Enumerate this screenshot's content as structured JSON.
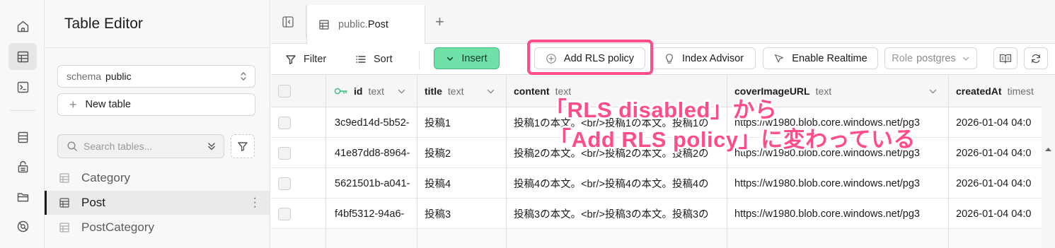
{
  "rail": {
    "items": [
      {
        "icon": "home-icon"
      },
      {
        "icon": "table-editor-icon",
        "active": true
      },
      {
        "icon": "sql-editor-icon"
      },
      {
        "icon": "database-icon"
      },
      {
        "icon": "auth-lock-icon"
      },
      {
        "icon": "storage-icon"
      },
      {
        "icon": "realtime-icon"
      }
    ]
  },
  "sidebar": {
    "title": "Table Editor",
    "schema_label": "schema",
    "schema_value": "public",
    "new_table_label": "New table",
    "search_placeholder": "Search tables...",
    "tables": [
      {
        "name": "Category",
        "active": false
      },
      {
        "name": "Post",
        "active": true
      },
      {
        "name": "PostCategory",
        "active": false
      }
    ]
  },
  "tabs": {
    "active_schema": "public.",
    "active_name": "Post"
  },
  "toolbar": {
    "filter": "Filter",
    "sort": "Sort",
    "insert": "Insert",
    "add_rls": "Add RLS policy",
    "index_advisor": "Index Advisor",
    "enable_realtime": "Enable Realtime",
    "role_label": "Role",
    "role_value": "postgres"
  },
  "grid": {
    "columns": [
      {
        "name": "id",
        "type": "text",
        "key": true
      },
      {
        "name": "title",
        "type": "text"
      },
      {
        "name": "content",
        "type": "text"
      },
      {
        "name": "coverImageURL",
        "type": "text"
      },
      {
        "name": "createdAt",
        "type": "timest"
      }
    ],
    "rows": [
      [
        "3c9ed14d-5b52-",
        "投稿1",
        "投稿1の本文。<br/>投稿1の本文。投稿1の",
        "https://w1980.blob.core.windows.net/pg3",
        "2026-01-04 04:0"
      ],
      [
        "41e87dd8-8964-",
        "投稿2",
        "投稿2の本文。<br/>投稿2の本文。投稿2の",
        "https://w1980.blob.core.windows.net/pg3",
        "2026-01-04 04:0"
      ],
      [
        "5621501b-a041-",
        "投稿4",
        "投稿4の本文。<br/>投稿4の本文。投稿4の",
        "https://w1980.blob.core.windows.net/pg3",
        "2026-01-04 04:0"
      ],
      [
        "f4bf5312-94a6-",
        "投稿3",
        "投稿3の本文。<br/>投稿3の本文。投稿3の",
        "https://w1980.blob.core.windows.net/pg3",
        "2026-01-04 04:0"
      ]
    ]
  },
  "annotation": {
    "line1": "「RLS disabled」から",
    "line2": "「Add RLS policy」に変わっている",
    "color": "#ff4d8a"
  },
  "colors": {
    "insert_bg": "#6ee0a8",
    "highlight": "#ff4d8a"
  }
}
